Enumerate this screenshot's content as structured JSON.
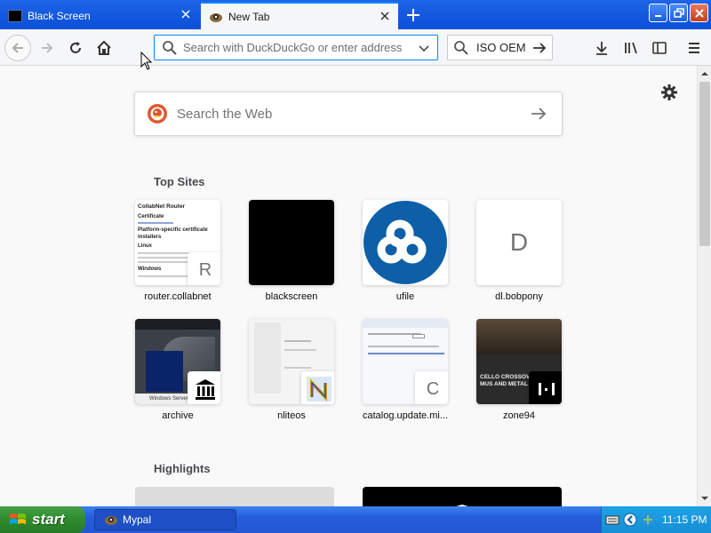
{
  "tabs": [
    {
      "title": "Black Screen",
      "active": false
    },
    {
      "title": "New Tab",
      "active": true
    }
  ],
  "toolbar": {
    "url_placeholder": "Search with DuckDuckGo or enter address",
    "search_text": "ISO OEM"
  },
  "newtab": {
    "search_placeholder": "Search the Web",
    "top_sites_title": "Top Sites",
    "highlights_title": "Highlights",
    "top_sites": [
      {
        "label": "router.collabnet",
        "badge": "R",
        "preview_heading": "CollabNet Router",
        "preview_sub": "Certificate",
        "preview_h2": "Platform-specific certificate installers",
        "preview_h3": "Linux",
        "preview_h4": "Windows"
      },
      {
        "label": "blackscreen"
      },
      {
        "label": "ufile"
      },
      {
        "label": "dl.bobpony",
        "letter": "D"
      },
      {
        "label": "archive",
        "preview_caption": "Windows Server"
      },
      {
        "label": "nliteos"
      },
      {
        "label": "catalog.update.mi...",
        "badge": "C"
      },
      {
        "label": "zone94",
        "preview_title": "CELLO CROSSOVER MUS AND METAL"
      }
    ]
  },
  "taskbar": {
    "start_label": "start",
    "task_label": "Mypal",
    "clock": "11:15 PM"
  },
  "colors": {
    "accent": "#0a84ff",
    "ufile_blue": "#0d5fa8",
    "taskbar_blue": "#245ddb",
    "start_green": "#2f8c2f"
  }
}
